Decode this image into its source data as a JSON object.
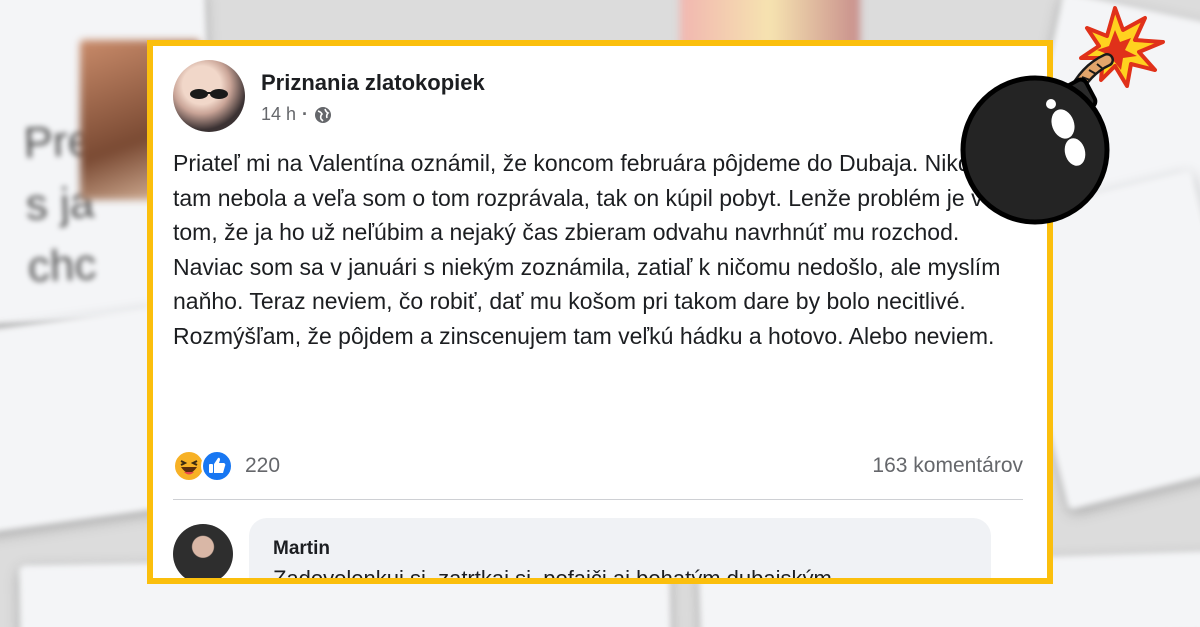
{
  "post": {
    "page_name": "Priznania zlatokopiek",
    "time": "14 h",
    "separator": "·",
    "privacy_icon": "globe-icon",
    "text": "Priateľ mi na Valentína oznámil, že koncom februára pôjdeme do Dubaja. Nikdy som tam nebola a veľa som o tom rozprávala, tak on kúpil pobyt. Lenže problém je v tom, že ja ho už neľúbim a nejaký čas zbieram odvahu navrhnúť mu rozchod. Naviac som sa v januári s niekým zoznámila, zatiaľ k ničomu nedošlo, ale myslím naňho. Teraz neviem, čo robiť, dať mu košom pri takom dare by bolo necitlivé. Rozmýšľam, že pôjdem a zinscenujem tam veľkú hádku a hotovo. Alebo neviem.",
    "reaction_icons": [
      "haha-icon",
      "like-icon"
    ],
    "reaction_count": "220",
    "comments_count": "163 komentárov"
  },
  "comment": {
    "author": "Martin",
    "text": "Zadovolenkuj si, zatrtkaj si, pofajči aj bohatým dubajským"
  },
  "colors": {
    "frame": "#fbbf0d",
    "text": "#1c1e21",
    "secondary_text": "#65676b",
    "like_blue": "#1877f2",
    "haha_yellow": "#f7b125"
  },
  "decor": {
    "sticker": "bomb-icon"
  }
}
